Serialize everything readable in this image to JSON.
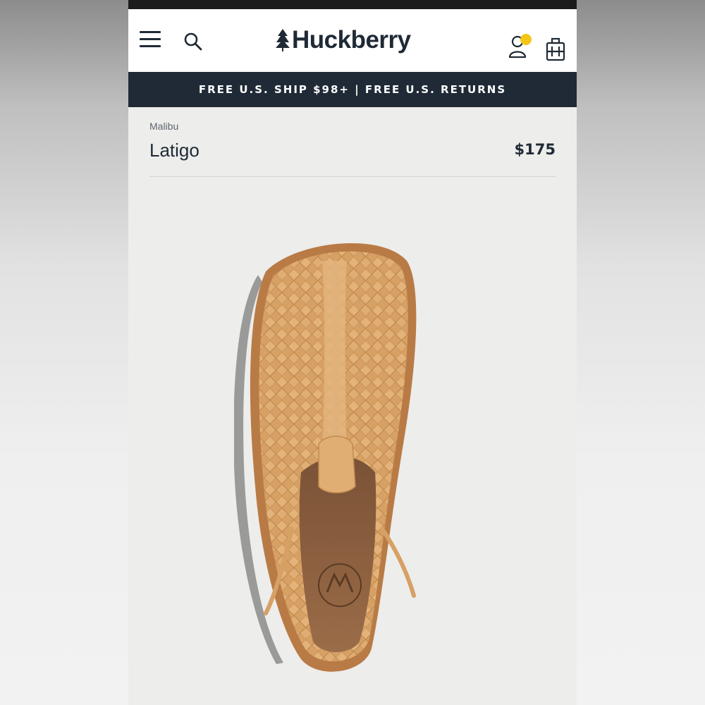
{
  "header": {
    "logo_text": "Huckberry",
    "menu_icon": "hamburger-menu-icon",
    "search_icon": "search-icon",
    "account_icon": "user-icon",
    "cart_icon": "cart-icon",
    "notification_color": "#f5c518"
  },
  "promo": {
    "text": "FREE U.S. SHIP $98+ | FREE U.S. RETURNS"
  },
  "product": {
    "brand": "Malibu",
    "name": "Latigo",
    "price": "$175",
    "image_icon": "woven-leather-sandal-image"
  },
  "colors": {
    "navy": "#1f2a36",
    "page_bg": "#ededeb",
    "leather": "#d9a468"
  }
}
